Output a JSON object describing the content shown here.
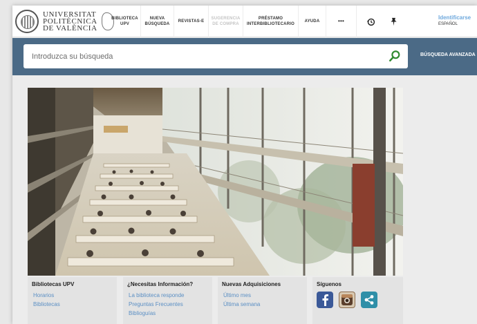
{
  "logo": {
    "line1": "UNIVERSITAT",
    "line2": "POLITÈCNICA",
    "line3": "DE VALÈNCIA"
  },
  "nav": {
    "items": [
      {
        "label_l1": "BIBLIOTECA",
        "label_l2": "UPV",
        "disabled": false
      },
      {
        "label_l1": "NUEVA",
        "label_l2": "BÚSQUEDA",
        "disabled": false
      },
      {
        "label_l1": "REVISTAS-E",
        "label_l2": "",
        "disabled": false
      },
      {
        "label_l1": "SUGERENCIA",
        "label_l2": "DE COMPRA",
        "disabled": true
      },
      {
        "label_l1": "PRÉSTAMO",
        "label_l2": "INTERBIBLIOTECARIO",
        "disabled": false
      },
      {
        "label_l1": "AYUDA",
        "label_l2": "",
        "disabled": false
      }
    ],
    "more_label": "•••",
    "history_icon": "history-icon",
    "pin_icon": "pin-icon"
  },
  "account": {
    "login_label": "Identificarse",
    "language": "ESPAÑOL"
  },
  "search": {
    "placeholder": "Introduzca su búsqueda",
    "advanced_label": "BÚSQUEDA AVANZADA",
    "button_icon": "search-icon"
  },
  "footer": {
    "columns": [
      {
        "title": "Bibliotecas UPV",
        "links": [
          "Horarios",
          "Bibliotecas"
        ]
      },
      {
        "title": "¿Necesitas Información?",
        "links": [
          "La biblioteca responde",
          "Preguntas Frecuentes",
          "Bibliogu­ías"
        ]
      },
      {
        "title": "Nuevas Adquisiciones",
        "links": [
          "Último mes",
          "Última semana"
        ]
      },
      {
        "title": "Síguenos",
        "links": []
      }
    ],
    "social": [
      {
        "icon": "facebook-icon",
        "color": "#3b5998"
      },
      {
        "icon": "instagram-icon",
        "color": "#b8865a"
      },
      {
        "icon": "share-icon",
        "color": "#2f8fa8"
      }
    ]
  },
  "colors": {
    "search_band": "#4b6a86",
    "accent_link": "#5b8fc4",
    "login": "#6fa9dd",
    "search_icon": "#2f8a2f"
  }
}
